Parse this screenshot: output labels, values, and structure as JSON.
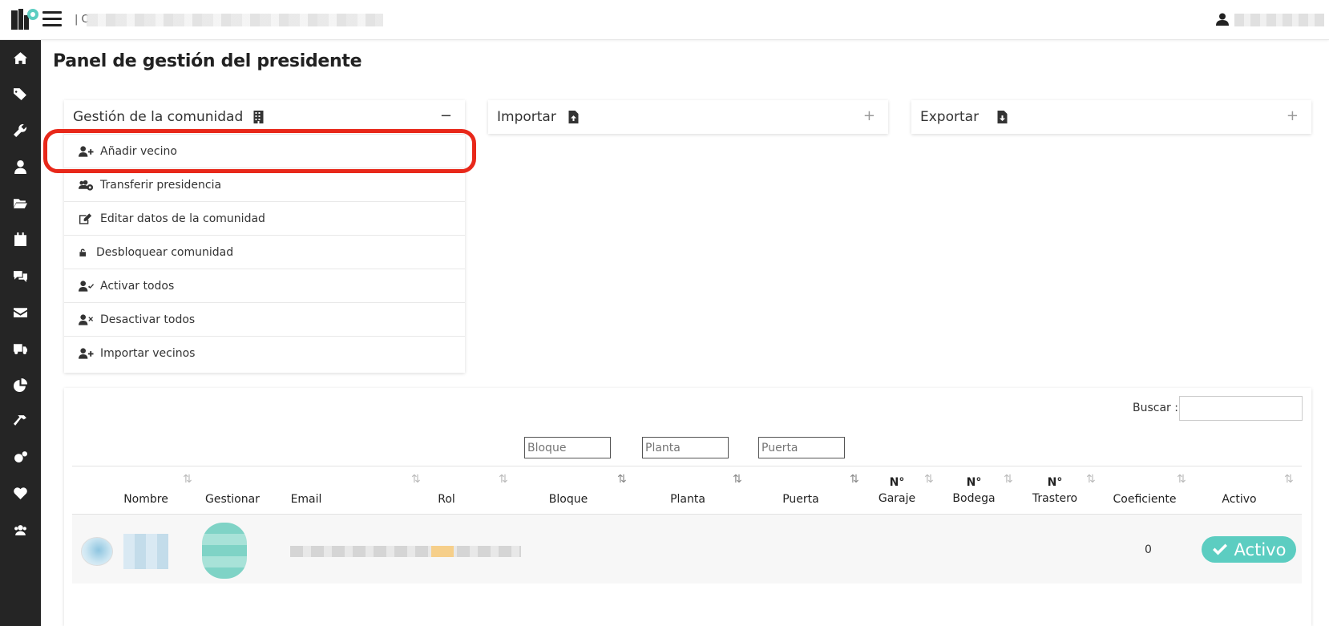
{
  "header": {
    "breadcrumb_prefix": "| C"
  },
  "page": {
    "title": "Panel de gestión del presidente"
  },
  "panels": {
    "gestion": {
      "title": "Gestión de la comunidad",
      "toggle": "−",
      "items": [
        {
          "label": "Añadir vecino",
          "icon": "user-plus-icon"
        },
        {
          "label": "Transferir presidencia",
          "icon": "users-cog-icon"
        },
        {
          "label": "Editar datos de la comunidad",
          "icon": "edit-icon"
        },
        {
          "label": "Desbloquear comunidad",
          "icon": "unlock-icon"
        },
        {
          "label": "Activar todos",
          "icon": "user-check-icon"
        },
        {
          "label": "Desactivar todos",
          "icon": "user-times-icon"
        },
        {
          "label": "Importar vecinos",
          "icon": "user-plus-icon"
        }
      ]
    },
    "importar": {
      "title": "Importar",
      "toggle": "+"
    },
    "exportar": {
      "title": "Exportar",
      "toggle": "+"
    }
  },
  "table": {
    "search_label": "Buscar :",
    "filters": {
      "bloque": "Bloque",
      "planta": "Planta",
      "puerta": "Puerta"
    },
    "columns": {
      "nombre": "Nombre",
      "gestionar": "Gestionar",
      "email": "Email",
      "rol": "Rol",
      "bloque": "Bloque",
      "planta": "Planta",
      "puerta": "Puerta",
      "garaje_1": "N°",
      "garaje_2": "Garaje",
      "bodega_1": "N°",
      "bodega_2": "Bodega",
      "trastero_1": "N°",
      "trastero_2": "Trastero",
      "coeficiente": "Coeficiente",
      "activo": "Activo"
    },
    "rows": [
      {
        "coeficiente": "0",
        "activo": "Activo"
      }
    ]
  },
  "colors": {
    "sidebar": "#252525",
    "highlight": "#e8281a",
    "active_badge": "#5ccdc1"
  },
  "sidebar_icons": [
    "home-icon",
    "tags-icon",
    "wrench-icon",
    "user-tie-icon",
    "folder-open-icon",
    "calendar-icon",
    "comments-icon",
    "envelope-icon",
    "truck-icon",
    "chart-pie-icon",
    "hammer-icon",
    "cogs-icon",
    "heart-icon",
    "users-icon"
  ]
}
